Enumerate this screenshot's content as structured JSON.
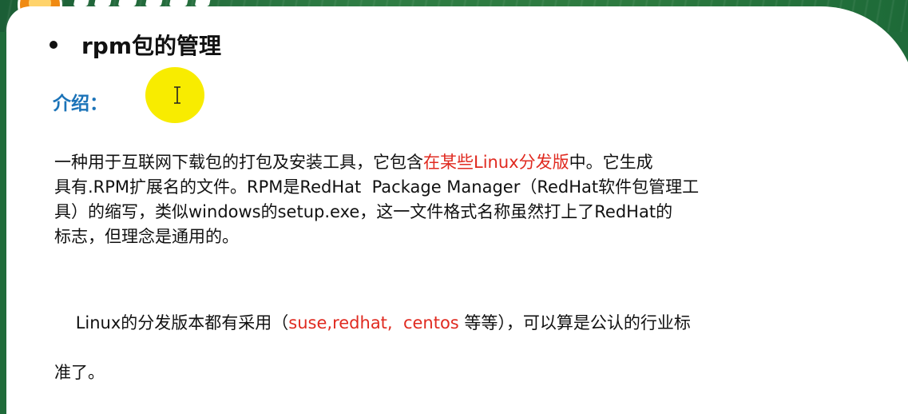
{
  "heading": "rpm包的管理",
  "intro_label": "介绍：",
  "paragraph1": {
    "line1_a": "一种用于互联网下载包的打包及安装工具，它包含",
    "line1_red": "在某些Linux分发版",
    "line1_b": "中。它生成",
    "line2": "具有.RPM扩展名的文件。RPM是RedHat  Package Manager（RedHat软件包管理工",
    "line3": "具）的缩写，类似windows的setup.exe，这一文件格式名称虽然打上了RedHat的",
    "line4": "标志，但理念是通用的。"
  },
  "paragraph2": {
    "line1_a": "Linux的分发版本都有采用（",
    "line1_red": "suse,redhat,  centos",
    "line1_b": " 等等），可以算是公认的行业标",
    "line2": "准了。"
  },
  "colors": {
    "heading": "#111111",
    "intro_label": "#1b73b8",
    "highlight_text": "#e02a20",
    "cursor_highlight": "#f8ec00"
  }
}
